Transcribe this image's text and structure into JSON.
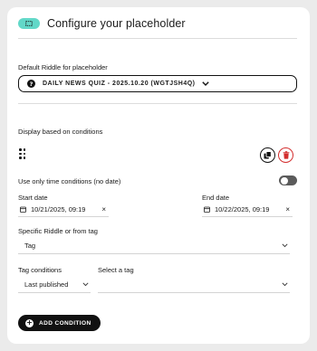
{
  "header": {
    "title": "Configure your placeholder",
    "icon": "placeholder-icon",
    "icon_color": "#62d8c8"
  },
  "default_riddle": {
    "label": "Default Riddle for placeholder",
    "value": "DAILY NEWS QUIZ - 2025.10.20 (WGTJSH4Q)",
    "icon": "question-icon"
  },
  "conditions": {
    "label": "Display based on conditions",
    "copy_icon": "copy-icon",
    "delete_icon": "trash-icon",
    "time_only": {
      "label": "Use only time conditions (no date)",
      "enabled": false
    },
    "start_date": {
      "label": "Start date",
      "value": "10/21/2025, 09:19",
      "clear": "×"
    },
    "end_date": {
      "label": "End date",
      "value": "10/22/2025, 09:19",
      "clear": "×"
    },
    "specific": {
      "label": "Specific Riddle or from tag",
      "value": "Tag"
    },
    "tag_conditions": {
      "label": "Tag conditions",
      "value": "Last published"
    },
    "select_tag": {
      "label": "Select a tag",
      "value": ""
    }
  },
  "add_condition": {
    "label": "ADD CONDITION"
  },
  "colors": {
    "accent": "#62d8c8",
    "delete": "#d32f2f",
    "dark": "#111111"
  }
}
